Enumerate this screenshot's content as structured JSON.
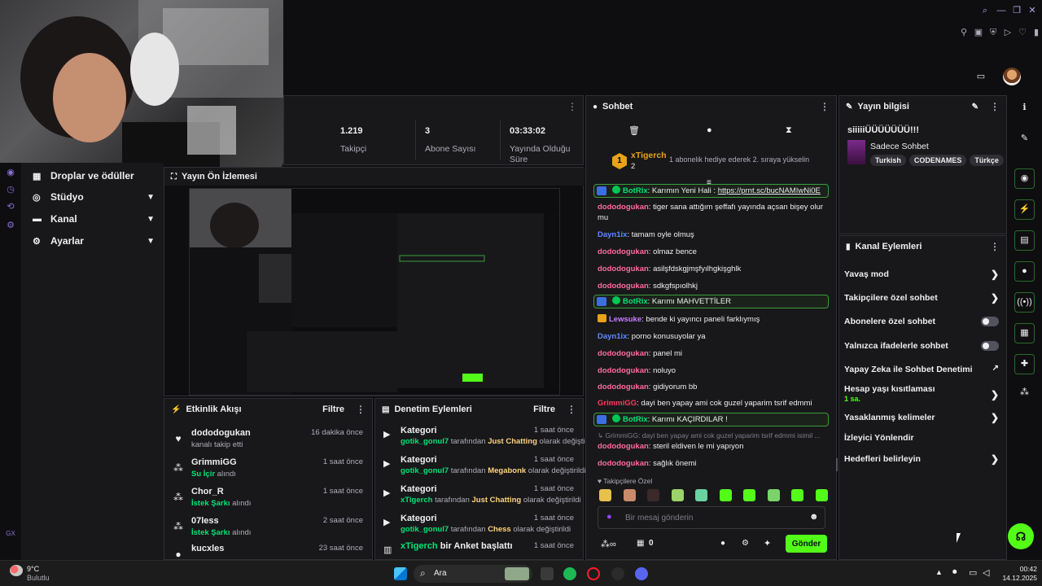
{
  "stats": {
    "followers_value": "1.219",
    "followers_label": "Takipçi",
    "subs_value": "3",
    "subs_label": "Abone Sayısı",
    "uptime_value": "03:33:02",
    "uptime_label_1": "Yayında Olduğu",
    "uptime_label_2": "Süre"
  },
  "leftnav": {
    "items": [
      {
        "label": "Droplar ve ödüller"
      },
      {
        "label": "Stüdyo"
      },
      {
        "label": "Kanal"
      },
      {
        "label": "Ayarlar"
      }
    ],
    "gx_label": "GX"
  },
  "preview": {
    "title": "Yayın Ön İzlemesi"
  },
  "activity": {
    "title": "Etkinlik Akışı",
    "filter": "Filtre",
    "events": [
      {
        "name": "dododogukan",
        "sub_prefix": "",
        "sub_highlight": "",
        "sub_suffix": "kanalı takip etti",
        "time": "16 dakika önce"
      },
      {
        "name": "GrimmiGG",
        "sub_prefix": "",
        "sub_highlight": "Su İçir",
        "sub_suffix": " alındı",
        "time": "1 saat önce"
      },
      {
        "name": "Chor_R",
        "sub_prefix": "",
        "sub_highlight": "İstek Şarkı",
        "sub_suffix": " alındı",
        "time": "1 saat önce"
      },
      {
        "name": "07less",
        "sub_prefix": "",
        "sub_highlight": "İstek Şarkı",
        "sub_suffix": " alındı",
        "time": "2 saat önce"
      },
      {
        "name": "kucxles",
        "sub_prefix": "",
        "sub_highlight": "",
        "sub_suffix": "",
        "time": "23 saat önce"
      }
    ]
  },
  "moderation": {
    "title": "Denetim Eylemleri",
    "filter": "Filtre",
    "items": [
      {
        "title": "Kategori",
        "user": "gotik_gonul7",
        "mid": " tarafından ",
        "target": "Just Chatting",
        "tail": " olarak değiştirildi",
        "time": "1 saat önce"
      },
      {
        "title": "Kategori",
        "user": "gotik_gonul7",
        "mid": " tarafından ",
        "target": "Megabonk",
        "tail": " olarak değiştirildi",
        "time": "1 saat önce"
      },
      {
        "title": "Kategori",
        "user": "xTigerch",
        "mid": " tarafından ",
        "target": "Just Chatting",
        "tail": " olarak değiştirildi",
        "time": "1 saat önce"
      },
      {
        "title": "Kategori",
        "user": "gotik_gonul7",
        "mid": " tarafından ",
        "target": "Chess",
        "tail": " olarak değiştirildi",
        "time": "1 saat önce"
      }
    ],
    "last_user": "xTigerch",
    "last_text": " bir Anket başlattı",
    "last_time": "1 saat önce"
  },
  "chat": {
    "title": "Sohbet",
    "top_user": "xTigerch",
    "top_count": "2",
    "gift_text": "1 abonelik hediye ederek 2. sıraya yükselin",
    "messages": [
      {
        "type": "bot",
        "user": "BotRix",
        "text": ": Karımın Yeni Hali : ",
        "link": "https://prnt.sc/bucNAMIwNi0E"
      },
      {
        "type": "msg",
        "user": "dododogukan",
        "color": "#ff6b9d",
        "text": ": tiger sana attığım şeffafı yayında açsan bişey olur mu"
      },
      {
        "type": "msg",
        "user": "Dayn1ix",
        "color": "#5b8cff",
        "text": ": tamam oyle olmuş"
      },
      {
        "type": "msg",
        "user": "dododogukan",
        "color": "#ff6b9d",
        "text": ": olmaz bence"
      },
      {
        "type": "msg",
        "user": "dododogukan",
        "color": "#ff6b9d",
        "text": ": asilşfdskgjmşfyılhgkişghlk"
      },
      {
        "type": "msg",
        "user": "dododogukan",
        "color": "#ff6b9d",
        "text": ": sdkgfspıolhkj"
      },
      {
        "type": "bot",
        "user": "BotRix",
        "text": ": Karımı MAHVETTİLER",
        "link": ""
      },
      {
        "type": "msg",
        "user": "Lewsuke",
        "color": "#c77dff",
        "text": ": bende ki yayıncı paneli farklıymış"
      },
      {
        "type": "msg",
        "user": "Dayn1ix",
        "color": "#5b8cff",
        "text": ": porno konusuyolar ya"
      },
      {
        "type": "msg",
        "user": "dododogukan",
        "color": "#ff6b9d",
        "text": ": panel mi"
      },
      {
        "type": "msg",
        "user": "dododogukan",
        "color": "#ff6b9d",
        "text": ": noluyo"
      },
      {
        "type": "msg",
        "user": "dododogukan",
        "color": "#ff6b9d",
        "text": ": gidiyorum bb"
      },
      {
        "type": "msg",
        "user": "GrimmiGG",
        "color": "#ff3b5c",
        "text": ": dayi ben yapay ami cok guzel yaparim tsrif edmmi"
      },
      {
        "type": "bot",
        "user": "BotRix",
        "text": ": Karımı KAÇIRDILAR !",
        "link": ""
      }
    ],
    "reply_preview": "GrimmiGG: dayi ben yapay ami cok guzel yaparim tsrif edmmi isimil ...",
    "after": [
      {
        "user": "dododogukan",
        "color": "#ff6b9d",
        "text": ": steril eldiven le mi yapıyon"
      },
      {
        "user": "dododogukan",
        "color": "#ff6b9d",
        "text": ": sağlık önemi"
      }
    ],
    "emote_section": "Takipçilere Özel",
    "input_placeholder": "Bir mesaj gönderin",
    "points": "0",
    "send": "Gönder"
  },
  "info": {
    "title": "Yayın bilgisi",
    "stream_title": "siiiiiÜÜÜÜÜÜÜ!!!",
    "category": "Sadece Sohbet",
    "tags": [
      "Turkish",
      "CODENAMES",
      "Türkçe"
    ]
  },
  "actions": {
    "title": "Kanal Eylemleri",
    "items": [
      {
        "label": "Yavaş mod",
        "kind": "arrow"
      },
      {
        "label": "Takipçilere özel sohbet",
        "kind": "arrow"
      },
      {
        "label": "Abonelere özel sohbet",
        "kind": "toggle"
      },
      {
        "label": "Yalnızca ifadelerle sohbet",
        "kind": "toggle"
      },
      {
        "label": "Yapay Zeka ile Sohbet Denetimi",
        "kind": "external"
      },
      {
        "label": "Hesap yaşı kısıtlaması",
        "kind": "arrow",
        "sub": "1 sa."
      },
      {
        "label": "Yasaklanmış kelimeler",
        "kind": "arrow"
      },
      {
        "label": "İzleyici Yönlendir",
        "kind": "none"
      },
      {
        "label": "Hedefleri belirleyin",
        "kind": "arrow"
      }
    ]
  },
  "taskbar": {
    "weather_temp": "9°C",
    "weather_desc": "Bulutlu",
    "search": "Ara",
    "time": "00:42",
    "date": "14.12.2025"
  },
  "colors": {
    "accent_green": "#53fc18",
    "bot_border": "#3b9b3b",
    "panel_bg": "#18181b"
  }
}
